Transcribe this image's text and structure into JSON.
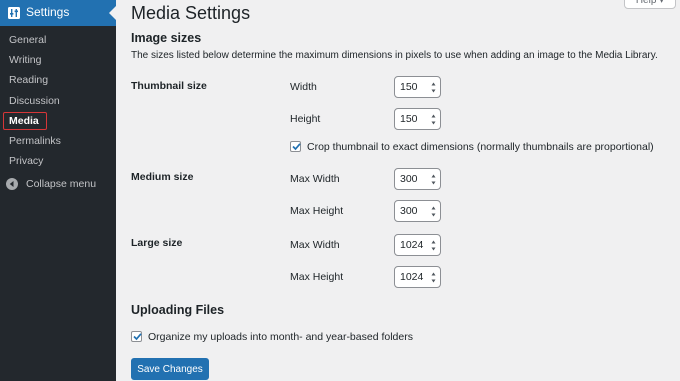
{
  "sidebar": {
    "title": "Settings",
    "items": [
      {
        "label": "General"
      },
      {
        "label": "Writing"
      },
      {
        "label": "Reading"
      },
      {
        "label": "Discussion"
      },
      {
        "label": "Media",
        "active": true
      },
      {
        "label": "Permalinks"
      },
      {
        "label": "Privacy"
      }
    ],
    "collapse_label": "Collapse menu"
  },
  "help_label": "Help ▾",
  "page_title": "Media Settings",
  "image_sizes": {
    "title": "Image sizes",
    "description": "The sizes listed below determine the maximum dimensions in pixels to use when adding an image to the Media Library.",
    "thumbnail": {
      "label": "Thumbnail size",
      "width_label": "Width",
      "width_value": "150",
      "height_label": "Height",
      "height_value": "150",
      "crop_label": "Crop thumbnail to exact dimensions (normally thumbnails are proportional)",
      "crop_checked": true
    },
    "medium": {
      "label": "Medium size",
      "max_width_label": "Max Width",
      "max_width_value": "300",
      "max_height_label": "Max Height",
      "max_height_value": "300"
    },
    "large": {
      "label": "Large size",
      "max_width_label": "Max Width",
      "max_width_value": "1024",
      "max_height_label": "Max Height",
      "max_height_value": "1024"
    }
  },
  "uploading": {
    "title": "Uploading Files",
    "organize_label": "Organize my uploads into month- and year-based folders",
    "organize_checked": true
  },
  "save_label": "Save Changes",
  "colors": {
    "accent": "#2271b1",
    "sidebar_bg": "#23282d",
    "highlight_outline": "#d63638"
  }
}
